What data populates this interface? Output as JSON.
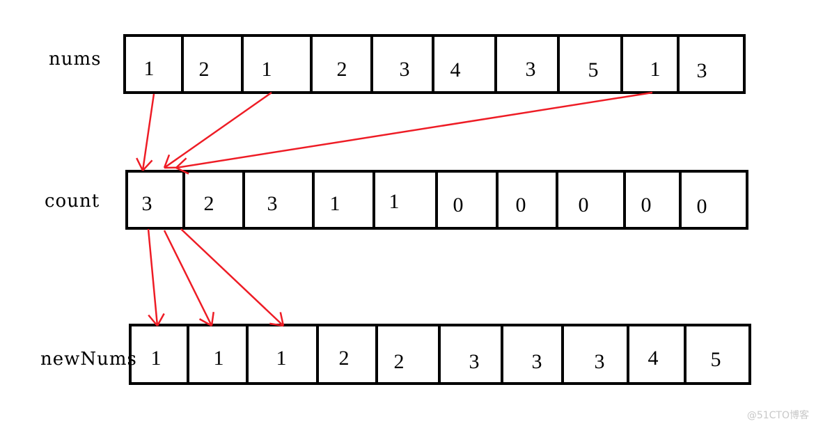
{
  "rows": [
    {
      "label": "nums",
      "values": [
        "1",
        "2",
        "1",
        "2",
        "3",
        "4",
        "3",
        "5",
        "1",
        "3"
      ]
    },
    {
      "label": "count",
      "values": [
        "3",
        "2",
        "3",
        "1",
        "1",
        "0",
        "0",
        "0",
        "0",
        "0"
      ]
    },
    {
      "label": "newNums",
      "values": [
        "1",
        "1",
        "1",
        "2",
        "2",
        "3",
        "3",
        "3",
        "4",
        "5"
      ]
    }
  ],
  "colors": {
    "cell_border": "#000000",
    "arrow": "#ee1c25"
  },
  "watermark": "@51CTO博客"
}
